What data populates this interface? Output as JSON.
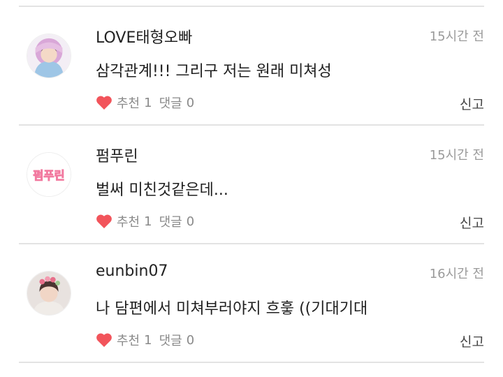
{
  "comments": [
    {
      "author": "LOVE태형오빠",
      "time": "15시간 전",
      "text": "삼각관계!!! 그리구 저는 원래 미쳐성",
      "like_label": "추천",
      "like_count": "1",
      "reply_label": "댓글",
      "reply_count": "0",
      "report_label": "신고",
      "avatar_icon": "profile-photo-icon",
      "heart_icon": "heart-icon"
    },
    {
      "author": "펌푸린",
      "time": "15시간 전",
      "text": "벌써 미친것같은데...",
      "like_label": "추천",
      "like_count": "1",
      "reply_label": "댓글",
      "reply_count": "0",
      "report_label": "신고",
      "avatar_logo_text": "펌푸린",
      "avatar_icon": "logo-text-icon",
      "heart_icon": "heart-icon"
    },
    {
      "author": "eunbin07",
      "time": "16시간 전",
      "text": "나 담편에서 미쳐부러야지 흐훟 ((기대기대",
      "like_label": "추천",
      "like_count": "1",
      "reply_label": "댓글",
      "reply_count": "0",
      "report_label": "신고",
      "avatar_icon": "profile-photo-icon",
      "heart_icon": "heart-icon"
    }
  ],
  "colors": {
    "heart": "#f2545b",
    "divider": "#e3e3e3",
    "time": "#9a9a9a",
    "meta": "#8a8a8a"
  }
}
